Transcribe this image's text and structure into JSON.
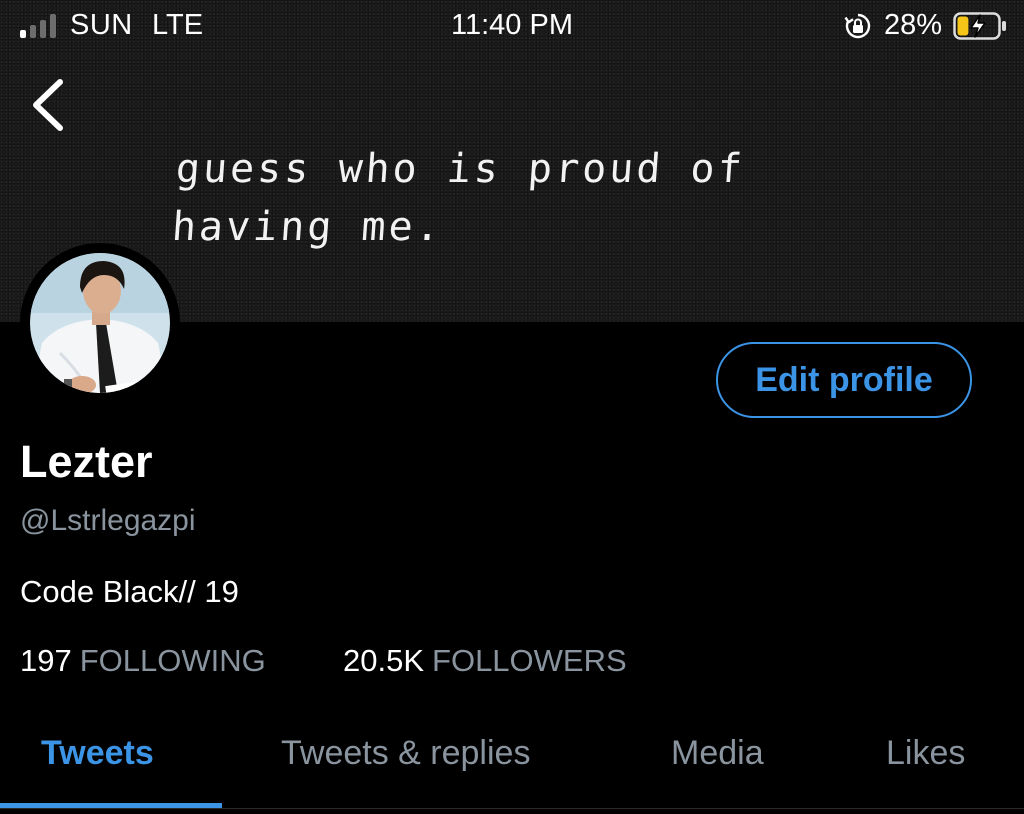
{
  "status_bar": {
    "carrier": "SUN",
    "network": "LTE",
    "time": "11:40 PM",
    "battery_percent": "28%",
    "signal_bars_filled": 1,
    "signal_bars_total": 4,
    "battery_level": 0.28,
    "battery_charging": true,
    "icons": [
      "signal-icon",
      "rotation-lock-icon",
      "battery-charging-icon"
    ]
  },
  "header": {
    "back_icon": "chevron-left-icon",
    "banner_text": "guess who is proud of having me."
  },
  "profile": {
    "display_name": "Lezter",
    "handle": "@Lstrlegazpi",
    "bio": "Code Black// 19",
    "edit_profile_label": "Edit profile",
    "following_count": "197",
    "following_label": "FOLLOWING",
    "followers_count": "20.5K",
    "followers_label": "FOLLOWERS"
  },
  "tabs": [
    {
      "label": "Tweets",
      "active": true
    },
    {
      "label": "Tweets & replies",
      "active": false
    },
    {
      "label": "Media",
      "active": false
    },
    {
      "label": "Likes",
      "active": false
    }
  ],
  "colors": {
    "background": "#000000",
    "accent": "#3b94e6",
    "secondary_text": "#8a949e",
    "battery_charging": "#f5c518"
  }
}
